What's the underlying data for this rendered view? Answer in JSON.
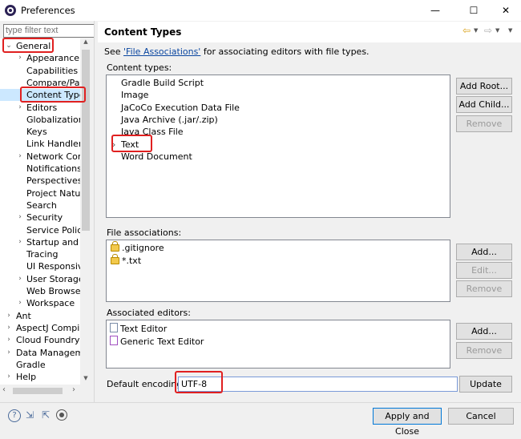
{
  "window": {
    "title": "Preferences",
    "minimize": "—",
    "maximize": "☐",
    "close": "✕"
  },
  "left": {
    "filter_placeholder": "type filter text",
    "tree": [
      {
        "label": "General",
        "arrow": "⌄",
        "level": 0,
        "expanded": true
      },
      {
        "label": "Appearance",
        "arrow": "›",
        "level": 1
      },
      {
        "label": "Capabilities",
        "arrow": "",
        "level": 1
      },
      {
        "label": "Compare/Patc",
        "arrow": "",
        "level": 1
      },
      {
        "label": "Content Type",
        "arrow": "",
        "level": 1,
        "selected": true
      },
      {
        "label": "Editors",
        "arrow": "›",
        "level": 1
      },
      {
        "label": "Globalization",
        "arrow": "",
        "level": 1
      },
      {
        "label": "Keys",
        "arrow": "",
        "level": 1
      },
      {
        "label": "Link Handlers",
        "arrow": "",
        "level": 1
      },
      {
        "label": "Network Conn",
        "arrow": "›",
        "level": 1
      },
      {
        "label": "Notifications",
        "arrow": "",
        "level": 1
      },
      {
        "label": "Perspectives",
        "arrow": "",
        "level": 1
      },
      {
        "label": "Project Nature",
        "arrow": "",
        "level": 1
      },
      {
        "label": "Search",
        "arrow": "",
        "level": 1
      },
      {
        "label": "Security",
        "arrow": "›",
        "level": 1
      },
      {
        "label": "Service Policie",
        "arrow": "",
        "level": 1
      },
      {
        "label": "Startup and Sh",
        "arrow": "›",
        "level": 1
      },
      {
        "label": "Tracing",
        "arrow": "",
        "level": 1
      },
      {
        "label": "UI Responsive",
        "arrow": "",
        "level": 1
      },
      {
        "label": "User Storage",
        "arrow": "›",
        "level": 1
      },
      {
        "label": "Web Browser",
        "arrow": "",
        "level": 1
      },
      {
        "label": "Workspace",
        "arrow": "›",
        "level": 1
      },
      {
        "label": "Ant",
        "arrow": "›",
        "level": 0
      },
      {
        "label": "AspectJ Compile",
        "arrow": "›",
        "level": 0
      },
      {
        "label": "Cloud Foundry",
        "arrow": "›",
        "level": 0
      },
      {
        "label": "Data Manageme",
        "arrow": "›",
        "level": 0
      },
      {
        "label": "Gradle",
        "arrow": "",
        "level": 0
      },
      {
        "label": "Help",
        "arrow": "›",
        "level": 0
      }
    ]
  },
  "main": {
    "title": "Content Types",
    "nav_icons": [
      "back-arrow-icon",
      "dropdown-icon",
      "forward-arrow-icon",
      "dropdown-icon",
      "menu-dropdown-icon"
    ],
    "intro_prefix": "See ",
    "intro_link": "'File Associations'",
    "intro_suffix": " for associating editors with file types.",
    "content_types_label": "Content types:",
    "content_types": [
      {
        "label": "Gradle Build Script",
        "arrow": ""
      },
      {
        "label": "Image",
        "arrow": ""
      },
      {
        "label": "JaCoCo Execution Data File",
        "arrow": ""
      },
      {
        "label": "Java Archive (.jar/.zip)",
        "arrow": ""
      },
      {
        "label": "Java Class File",
        "arrow": ""
      },
      {
        "label": "Text",
        "arrow": "›"
      },
      {
        "label": "Word Document",
        "arrow": ""
      }
    ],
    "add_root": "Add Root...",
    "add_child": "Add Child...",
    "remove": "Remove",
    "file_assoc_label": "File associations:",
    "file_assoc": [
      ".gitignore",
      "*.txt"
    ],
    "add": "Add...",
    "edit": "Edit...",
    "assoc_editors_label": "Associated editors:",
    "assoc_editors": [
      "Text Editor",
      "Generic Text Editor"
    ],
    "encoding_label": "Default encoding:",
    "encoding_value": "UTF-8",
    "update": "Update"
  },
  "footer": {
    "apply_close": "Apply and Close",
    "cancel": "Cancel",
    "icons": [
      "help-icon",
      "import-icon",
      "export-icon",
      "record-icon"
    ]
  },
  "colors": {
    "highlight": "#e02020",
    "link": "#0a46a0",
    "selection": "#cce8ff"
  }
}
